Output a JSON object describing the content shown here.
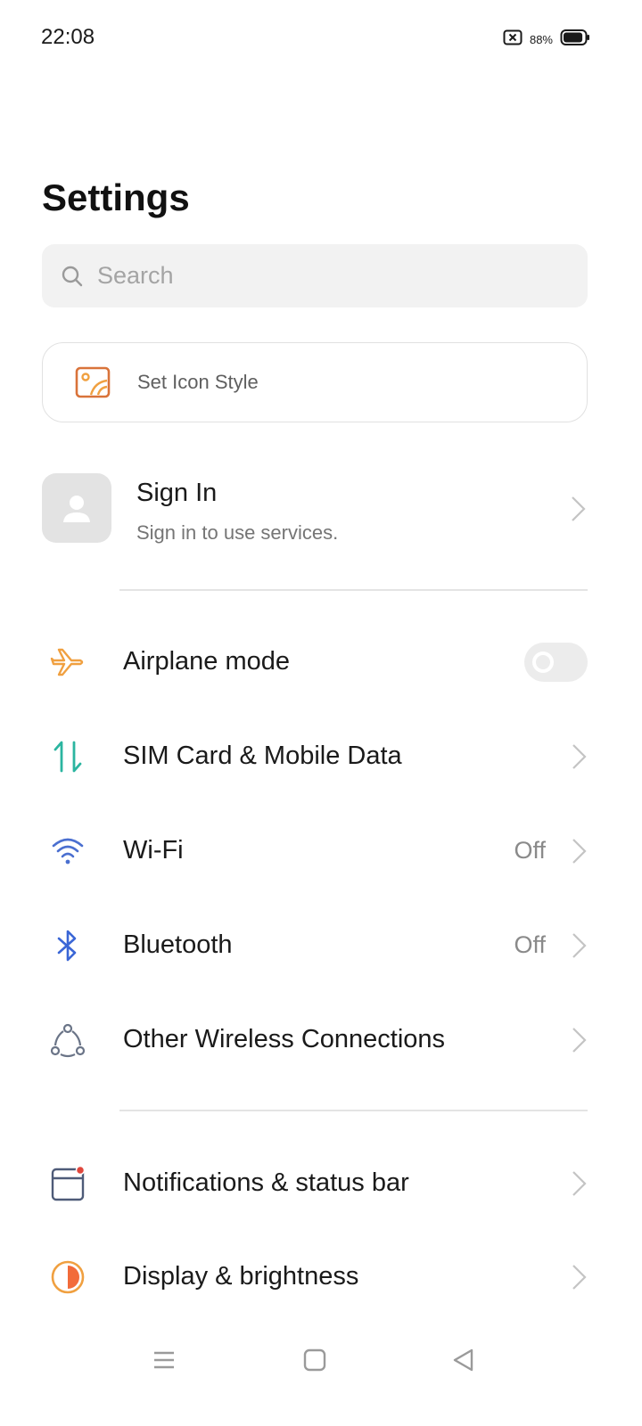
{
  "status_bar": {
    "time": "22:08",
    "battery_percent_text": "88%",
    "battery_level": 0.88,
    "icons": [
      "screenshot-blocked-icon",
      "battery-icon"
    ]
  },
  "header": {
    "title": "Settings"
  },
  "search": {
    "placeholder": "Search"
  },
  "icon_style_card": {
    "label": "Set Icon Style",
    "icon": "icon-style-icon",
    "accent": "#e07a3a"
  },
  "account": {
    "title": "Sign In",
    "subtitle": "Sign in to use services."
  },
  "connectivity": {
    "items": [
      {
        "label": "Airplane mode",
        "icon": "airplane-icon",
        "color": "#f0a040",
        "control": "toggle",
        "toggle_on": false
      },
      {
        "label": "SIM Card & Mobile Data",
        "icon": "mobile-data-icon",
        "color": "#2bb5a0",
        "control": "chevron"
      },
      {
        "label": "Wi-Fi",
        "icon": "wifi-icon",
        "color": "#4a6fd0",
        "value": "Off",
        "control": "chevron"
      },
      {
        "label": "Bluetooth",
        "icon": "bluetooth-icon",
        "color": "#3a66d6",
        "value": "Off",
        "control": "chevron"
      },
      {
        "label": "Other Wireless Connections",
        "icon": "wireless-connections-icon",
        "color": "#6a7487",
        "control": "chevron"
      }
    ]
  },
  "system": {
    "items": [
      {
        "label": "Notifications & status bar",
        "icon": "notifications-icon",
        "color": "#4e5b78",
        "badge_color": "#e0463c",
        "control": "chevron"
      },
      {
        "label": "Display & brightness",
        "icon": "display-brightness-icon",
        "color": "#f09a3a",
        "control": "chevron"
      }
    ]
  },
  "nav_bar": {
    "icons": [
      "menu-icon",
      "home-icon",
      "back-icon"
    ]
  }
}
